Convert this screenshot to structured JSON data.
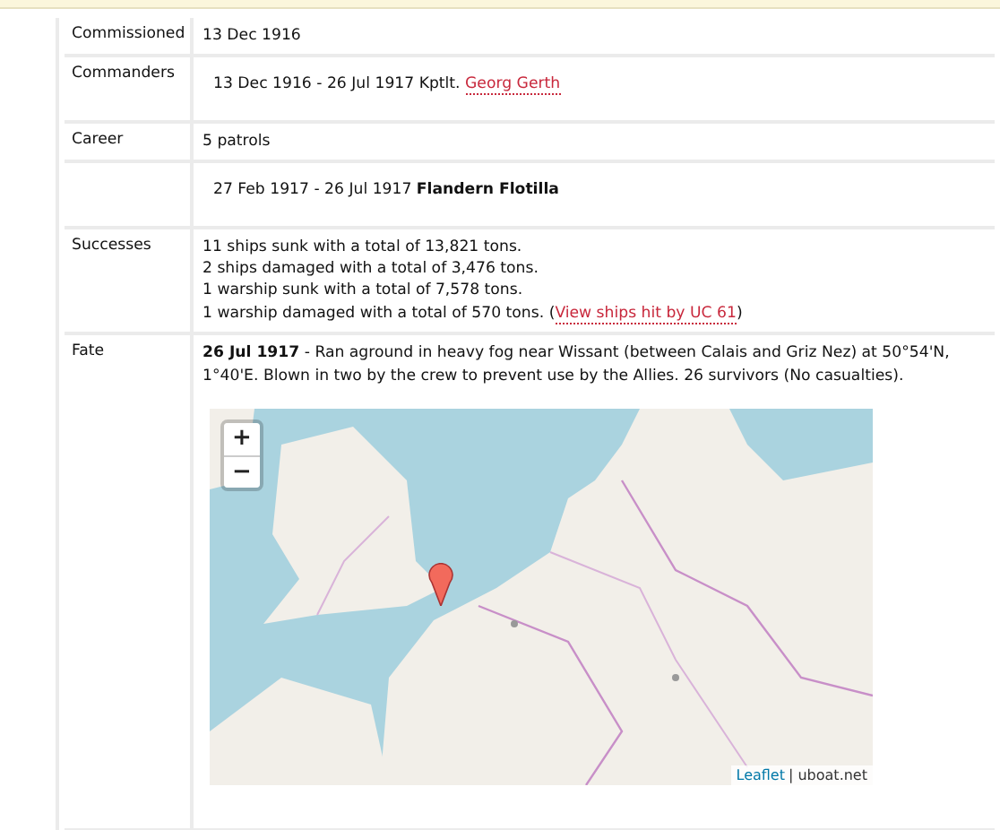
{
  "rows": [
    {
      "label": "Commissioned",
      "kind": "plain",
      "lines": [
        [
          {
            "kind": "text",
            "text": "13 Dec 1916"
          }
        ]
      ]
    },
    {
      "label": "Commanders",
      "kind": "entry",
      "lines": [
        [
          {
            "kind": "text",
            "text": "13 Dec 1916 - 26 Jul 1917  Kptlt. "
          },
          {
            "kind": "link",
            "text": "Georg Gerth"
          }
        ]
      ]
    },
    {
      "label": "Career",
      "kind": "plain",
      "lines": [
        [
          {
            "kind": "text",
            "text": "5 patrols"
          }
        ]
      ]
    },
    {
      "kind": "entry",
      "lines": [
        [
          {
            "kind": "text",
            "text": "27 Feb 1917  - 26 Jul 1917  **Flandern Flotilla**"
          }
        ]
      ]
    },
    {
      "label": "Successes",
      "kind": "plain",
      "lines": [
        [
          {
            "kind": "text",
            "text": "11 ships sunk with a total of 13,821 tons."
          }
        ],
        [
          {
            "kind": "text",
            "text": "2 ships damaged with a total of 3,476 tons."
          }
        ],
        [
          {
            "kind": "text",
            "text": "1 warship sunk with a total of 7,578 tons."
          }
        ],
        [
          {
            "kind": "text",
            "text": "1 warship damaged with a total of 570 tons. ("
          },
          {
            "kind": "link",
            "text": "View ships hit by UC 61"
          },
          {
            "kind": "text",
            "text": ")"
          }
        ]
      ]
    },
    {
      "label": "Fate",
      "kind": "plain",
      "lines": [
        [
          {
            "kind": "text",
            "text": "**26 Jul 1917** - Ran aground in heavy fog near Wissant (between Calais and Griz Nez) at 50°54'N, 1°40'E. Blown in two by the crew to prevent use by the Allies. 26 survivors (No casualties)."
          }
        ]
      ],
      "map": {
        "zoom_in": "+",
        "zoom_out": "−",
        "attribution_link": "Leaflet",
        "attribution": "| uboat.net"
      }
    }
  ]
}
